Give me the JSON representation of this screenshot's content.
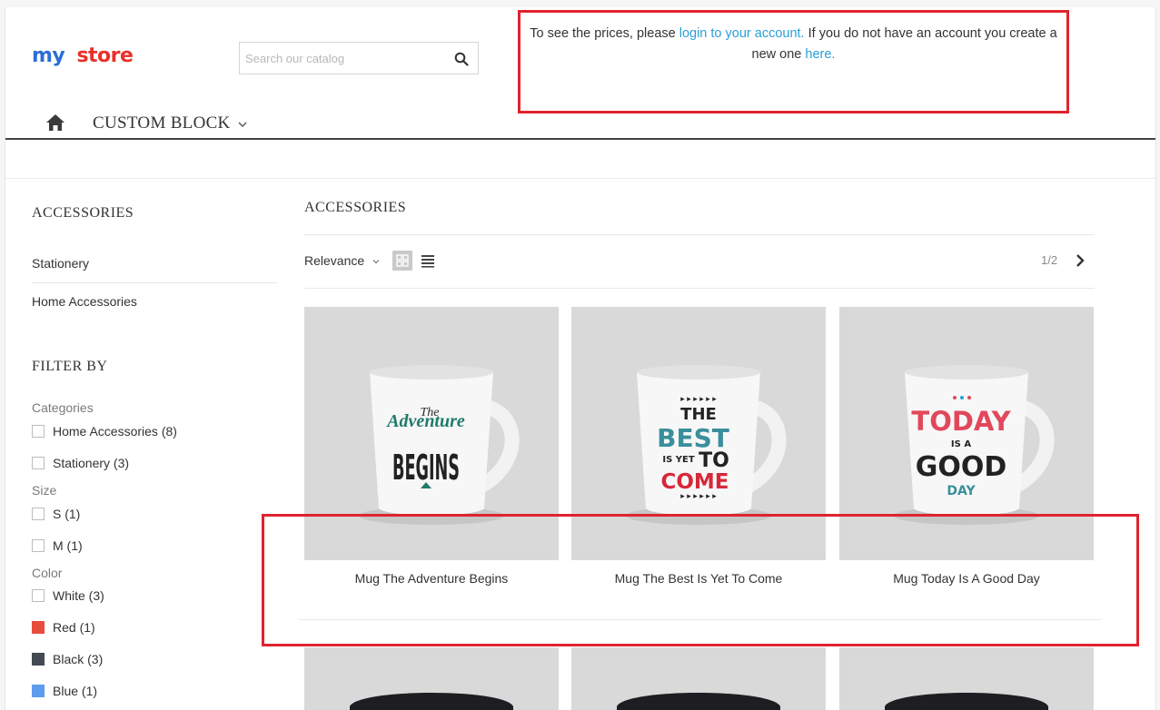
{
  "header": {
    "logo": {
      "word1": "my",
      "word2": "store"
    },
    "search": {
      "placeholder": "Search our catalog"
    },
    "notice": {
      "pre": "To see the prices, please ",
      "login_link": "login to your account.",
      "mid": " If you do not have an account you create a new one ",
      "here_link": "here."
    }
  },
  "nav": {
    "home_icon": "home-icon",
    "items": [
      {
        "label": "CUSTOM BLOCK"
      }
    ]
  },
  "sidebar": {
    "category_title": "ACCESSORIES",
    "subcategories": [
      {
        "label": "Stationery"
      },
      {
        "label": "Home Accessories"
      }
    ],
    "filter_title": "FILTER BY",
    "facets": {
      "categories": {
        "label": "Categories",
        "options": [
          {
            "label": "Home Accessories (8)"
          },
          {
            "label": "Stationery (3)"
          }
        ]
      },
      "size": {
        "label": "Size",
        "options": [
          {
            "label": "S (1)"
          },
          {
            "label": "M (1)"
          }
        ]
      },
      "color": {
        "label": "Color",
        "options": [
          {
            "label": "White (3)",
            "color": "#ffffff"
          },
          {
            "label": "Red (1)",
            "color": "#e84c3d"
          },
          {
            "label": "Black (3)",
            "color": "#434a54"
          },
          {
            "label": "Blue (1)",
            "color": "#5d9cec"
          }
        ]
      }
    }
  },
  "main": {
    "title": "ACCESSORIES",
    "sort": {
      "selected": "Relevance"
    },
    "pagination": "1/2",
    "products": [
      {
        "name": "Mug The Adventure Begins",
        "print": {
          "l1": "The",
          "l2": "Adventure",
          "l3": "BEGINS"
        }
      },
      {
        "name": "Mug The Best Is Yet To Come",
        "print": {
          "l1": "THE",
          "l2": "BEST",
          "l3": "IS YET",
          "l4": "TO",
          "l5": "COME"
        }
      },
      {
        "name": "Mug Today Is A Good Day",
        "print": {
          "l1": "TODAY",
          "l2": "IS A",
          "l3": "GOOD",
          "l4": "DAY"
        }
      }
    ]
  },
  "colors": {
    "accent": "#2a9fd8",
    "highlight": "#e0232f"
  }
}
